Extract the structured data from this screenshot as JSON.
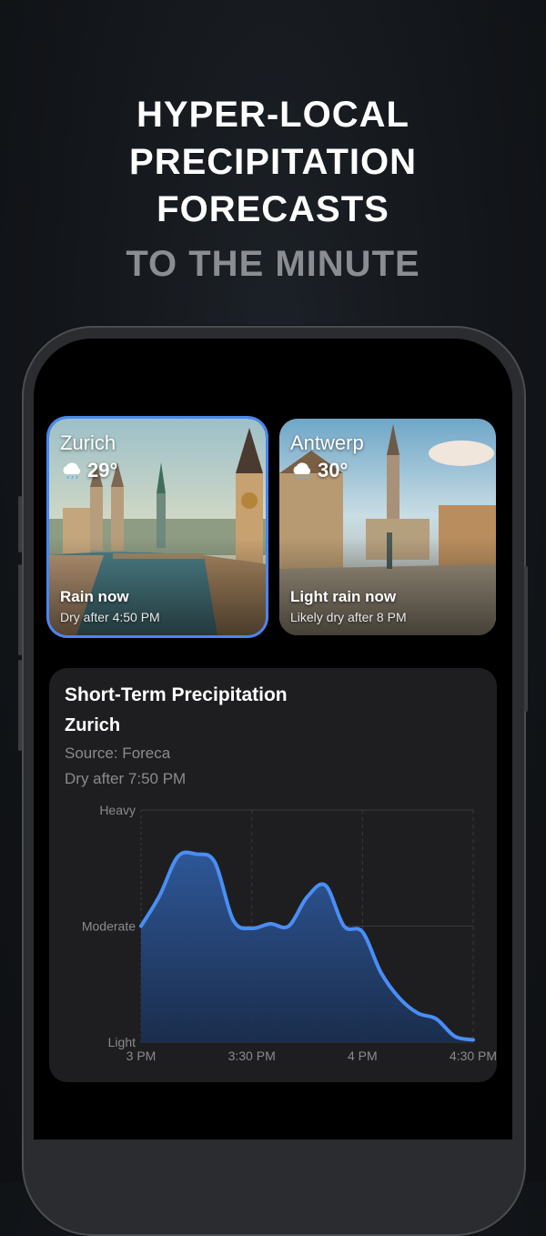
{
  "headline": {
    "line1": "HYPER-LOCAL",
    "line2": "PRECIPITATION",
    "line3": "FORECASTS",
    "sub": "TO THE MINUTE"
  },
  "colors": {
    "accent": "#4a86f0",
    "card_bg": "#1e1e20",
    "muted_text": "#8b8b8f"
  },
  "cities": [
    {
      "name": "Zurich",
      "icon": "rain-cloud-icon",
      "temp": "29°",
      "status": "Rain now",
      "detail": "Dry after 4:50 PM",
      "selected": true
    },
    {
      "name": "Antwerp",
      "icon": "rain-cloud-icon",
      "temp": "30°",
      "status": "Light rain now",
      "detail": "Likely dry after 8 PM",
      "selected": false
    }
  ],
  "precip": {
    "title": "Short-Term Precipitation",
    "city": "Zurich",
    "source": "Source: Foreca",
    "dry": "Dry after 7:50 PM"
  },
  "chart_data": {
    "type": "area",
    "title": "Short-Term Precipitation",
    "x_ticks": [
      "3 PM",
      "3:30 PM",
      "4 PM",
      "4:30 PM"
    ],
    "y_ticks": [
      "Light",
      "Moderate",
      "Heavy"
    ],
    "y_range": [
      0,
      2
    ],
    "grid": true,
    "series": [
      {
        "x_minutes": [
          0,
          5,
          10,
          15,
          20,
          25,
          30,
          35,
          40,
          45,
          50,
          55,
          60,
          65,
          70,
          75,
          80,
          85,
          90
        ],
        "values": [
          1.0,
          1.26,
          1.6,
          1.62,
          1.55,
          1.05,
          0.98,
          1.02,
          1.0,
          1.25,
          1.35,
          1.0,
          0.95,
          0.6,
          0.38,
          0.25,
          0.2,
          0.05,
          0.02
        ]
      }
    ]
  }
}
